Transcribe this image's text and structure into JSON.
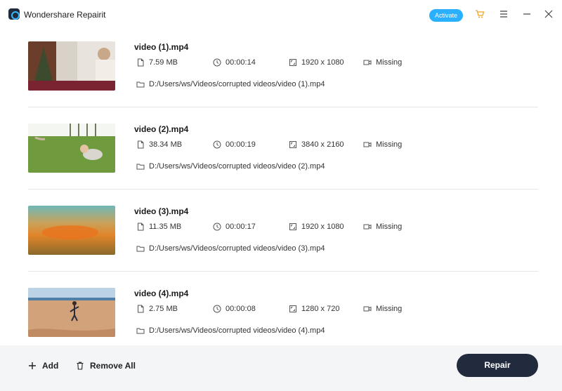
{
  "app": {
    "title": "Wondershare Repairit",
    "activate_label": "Activate",
    "accent_color": "#2ab0ff",
    "icons": [
      "app-logo-icon",
      "cart-icon",
      "menu-icon",
      "minimize-icon",
      "close-icon"
    ]
  },
  "files": [
    {
      "name": "video (1).mp4",
      "size": "7.59  MB",
      "duration": "00:00:14",
      "resolution": "1920 x 1080",
      "status": "Missing",
      "path": "D:/Users/ws/Videos/corrupted videos/video (1).mp4"
    },
    {
      "name": "video (2).mp4",
      "size": "38.34  MB",
      "duration": "00:00:19",
      "resolution": "3840 x 2160",
      "status": "Missing",
      "path": "D:/Users/ws/Videos/corrupted videos/video (2).mp4"
    },
    {
      "name": "video (3).mp4",
      "size": "11.35  MB",
      "duration": "00:00:17",
      "resolution": "1920 x 1080",
      "status": "Missing",
      "path": "D:/Users/ws/Videos/corrupted videos/video (3).mp4"
    },
    {
      "name": "video (4).mp4",
      "size": "2.75  MB",
      "duration": "00:00:08",
      "resolution": "1280 x 720",
      "status": "Missing",
      "path": "D:/Users/ws/Videos/corrupted videos/video (4).mp4"
    }
  ],
  "footer": {
    "add_label": "Add",
    "remove_all_label": "Remove All",
    "repair_label": "Repair",
    "repair_color": "#222b3e"
  }
}
